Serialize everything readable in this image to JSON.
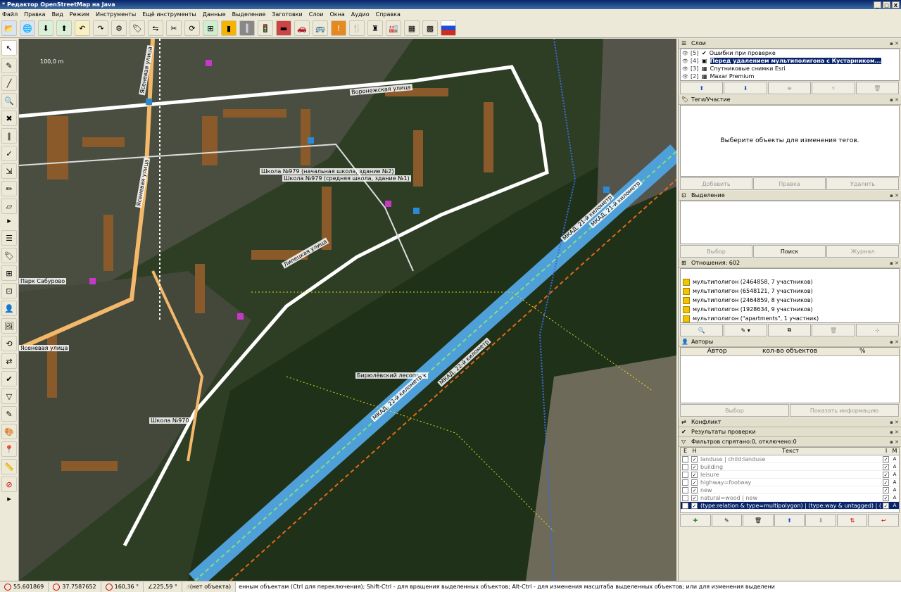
{
  "window": {
    "title": "* Редактор OpenStreetMap на Java",
    "min": "_",
    "max": "□",
    "close": "X"
  },
  "menu": [
    "Файл",
    "Правка",
    "Вид",
    "Режим",
    "Инструменты",
    "Ещё инструменты",
    "Данные",
    "Выделение",
    "Заготовки",
    "Слои",
    "Окна",
    "Аудио",
    "Справка"
  ],
  "map": {
    "scale": "100,0 m",
    "labels": {
      "voronezhskaya": "Воронежская улица",
      "school_primary": "Школа №979 (начальная школа, здание №2)",
      "school_secondary": "Школа №979 (средняя школа, здание №1)",
      "yasenevaya1": "Ясеневая улица",
      "yasenevaya2": "Ясеневая улица",
      "yasenevaya3": "Ясеневая улица",
      "saburovo": "Парк Сабурово",
      "school970": "Школа №970",
      "biryulevsky": "Бирюлёвский лесопарк",
      "mkad1": "МКАД, 22-й километр",
      "mkad2": "МКАД, 22-й километр",
      "mkad3": "МКАД, 21-й километр",
      "mkad4": "МКАД, 21-й километр",
      "lipetskaya": "Липецкая улица"
    }
  },
  "panels": {
    "layers": {
      "title": "Слои",
      "items": [
        {
          "num": "[5]",
          "name": "Ошибки при проверке",
          "selected": false
        },
        {
          "num": "[4]",
          "name": "Перед удалением мультиполигона с Кустарником...",
          "selected": true
        },
        {
          "num": "[3]",
          "name": "Спутниковые снимки Esri",
          "selected": false
        },
        {
          "num": "[2]",
          "name": "Maxar Premium",
          "selected": false
        }
      ]
    },
    "tags": {
      "title": "Теги/Участие",
      "empty_text": "Выберите объекты для изменения тегов.",
      "buttons": [
        "Добавить",
        "Правка",
        "Удалить"
      ]
    },
    "selection": {
      "title": "Выделение",
      "buttons": [
        "Выбор",
        "Поиск",
        "Журнал"
      ]
    },
    "relations": {
      "title": "Отношения: 602",
      "items": [
        "мультиполигон (2464858, 7 участников)",
        "мультиполигон (6548121, 7 участников)",
        "мультиполигон (2464859, 8 участников)",
        "мультиполигон (1928634, 9 участников)",
        "мультиполигон (\"apartments\", 1 участник)"
      ]
    },
    "authors": {
      "title": "Авторы",
      "columns": [
        "Автор",
        "кол-во объектов",
        "%"
      ],
      "buttons": [
        "Выбор",
        "Показать информацию"
      ]
    },
    "conflict": {
      "title": "Конфликт"
    },
    "validation": {
      "title": "Результаты проверки"
    },
    "filter": {
      "title": "Фильтров спрятано:0, отключено:0",
      "columns": [
        "E",
        "H",
        "Текст",
        "I",
        "M"
      ],
      "rows": [
        {
          "text": "landuse | child:landuse",
          "m": "A",
          "selected": false
        },
        {
          "text": "building",
          "m": "A",
          "selected": false
        },
        {
          "text": "leisure",
          "m": "A",
          "selected": false
        },
        {
          "text": "highway=footway",
          "m": "A",
          "selected": false
        },
        {
          "text": "new",
          "m": "A",
          "selected": false
        },
        {
          "text": "natural=wood | new",
          "m": "A",
          "selected": false
        },
        {
          "text": "(type:relation & type=multipolygon) | (type:way & untagged) | (type:way ...",
          "m": "A",
          "selected": true
        }
      ]
    }
  },
  "status": {
    "lat": "55.601869",
    "lon": "37.7587652",
    "heading": "160,36 °",
    "angle": "225,59 °",
    "object": "(нет объекта)",
    "hint": "енным объектам (Ctrl для переключения); Shift-Ctrl - для вращения выделенных объектов; Alt-Ctrl - для изменения масштаба выделенных объектов; или для изменения выделени"
  },
  "colors": {
    "highway": "#4fa0d8",
    "trunk_edge": "#7fe07f",
    "building": "#8a5a2a",
    "road": "#ffffff",
    "yasenevaya": "#f4b86a"
  }
}
